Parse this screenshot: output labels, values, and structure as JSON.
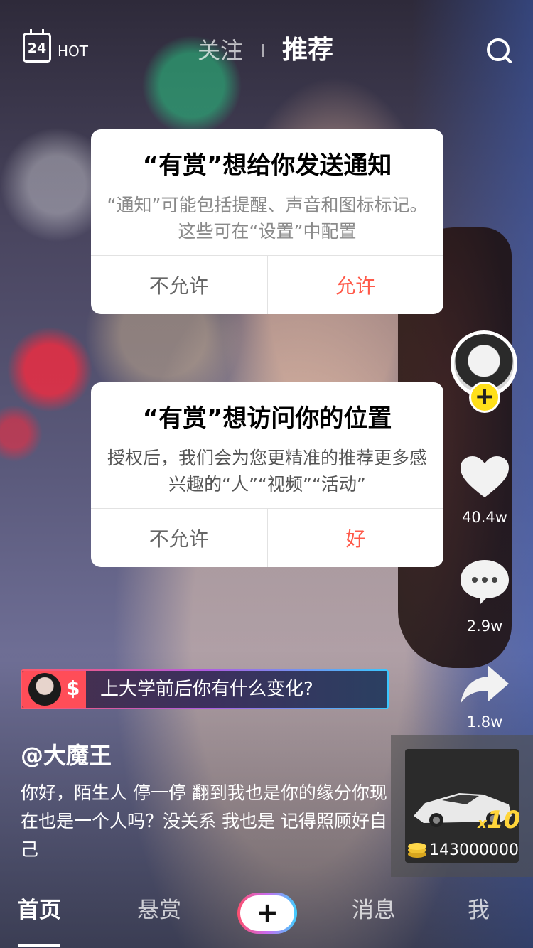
{
  "header": {
    "calendar_day": "24",
    "hot_label": "HOT",
    "tab_follow": "关注",
    "tab_recommend": "推荐"
  },
  "notification_dialog": {
    "title": "“有赏”想给你发送通知",
    "message": "“通知”可能包括提醒、声音和图标标记。这些可在“设置”中配置",
    "deny_label": "不允许",
    "allow_label": "允许"
  },
  "location_dialog": {
    "title": "“有赏”想访问你的位置",
    "message": "授权后，我们会为您更精准的推荐更多感兴趣的“人”“视频”“活动”",
    "deny_label": "不允许",
    "allow_label": "好"
  },
  "actions": {
    "likes": "40.4w",
    "comments": "2.9w",
    "shares": "1.8w"
  },
  "gift": {
    "multiplier_prefix": "x",
    "multiplier": "10",
    "coins": "143000000"
  },
  "question_banner": {
    "currency_symbol": "$",
    "text": "上大学前后你有什么变化?"
  },
  "post": {
    "username": "@大魔王",
    "description": "你好，陌生人 停一停 翻到我也是你的缘分你现在也是一个人吗？没关系 我也是 记得照顾好自己"
  },
  "nav": {
    "home": "首页",
    "reward": "悬赏",
    "create": "+",
    "messages": "消息",
    "me": "我"
  },
  "colors": {
    "accent_red": "#ff5a4a",
    "follow_yellow": "#ffe01a",
    "gift_gold": "#ffd53a"
  }
}
